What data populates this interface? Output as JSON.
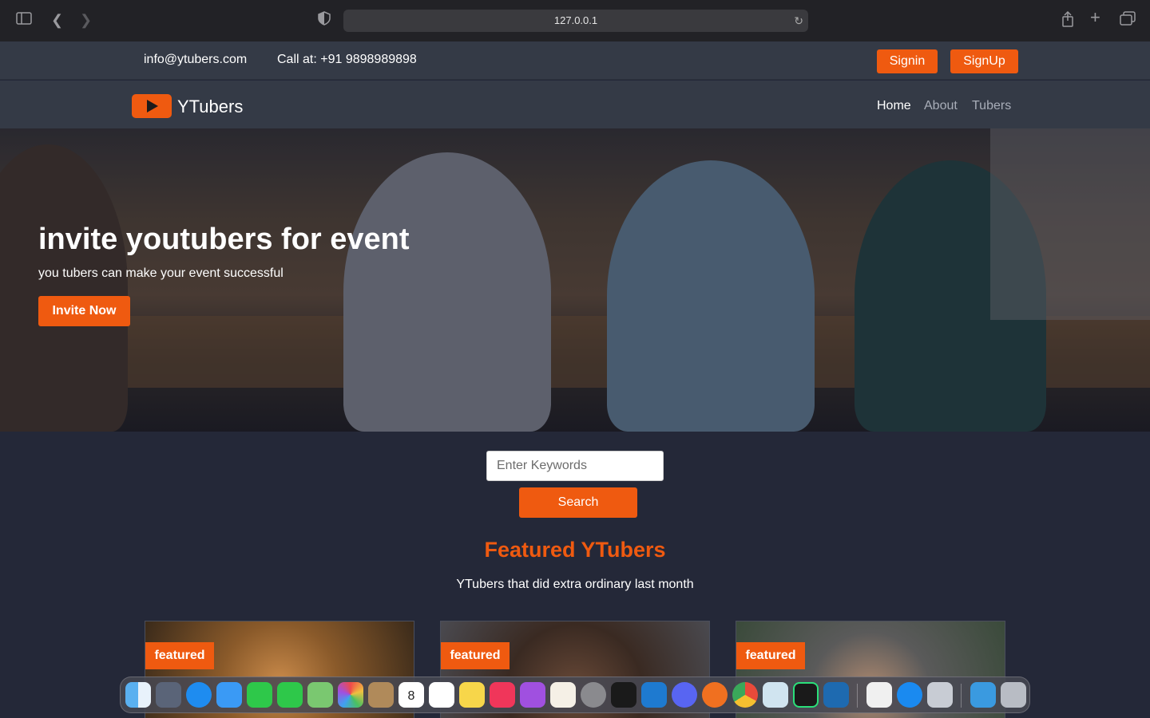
{
  "browser": {
    "url": "127.0.0.1"
  },
  "topbar": {
    "email": "info@ytubers.com",
    "phone": "Call at: +91 9898989898",
    "signin": "Signin",
    "signup": "SignUp"
  },
  "navbar": {
    "brand": "YTubers",
    "links": [
      "Home",
      "About",
      "Tubers"
    ],
    "active": "Home"
  },
  "hero": {
    "title": "invite youtubers for event",
    "subtitle": "you tubers can make your event successful",
    "cta": "Invite Now"
  },
  "search": {
    "placeholder": "Enter Keywords",
    "button": "Search"
  },
  "featured": {
    "title": "Featured YTubers",
    "subtitle": "YTubers that did extra ordinary last month",
    "cards": [
      {
        "badge": "featured"
      },
      {
        "badge": "featured"
      },
      {
        "badge": "featured"
      }
    ]
  },
  "dock": {
    "icons": [
      "finder-icon",
      "launchpad-icon",
      "safari-icon",
      "mail-icon",
      "facetime-icon",
      "messages-icon",
      "maps-icon",
      "photos-icon",
      "contacts-icon",
      "calendar-icon",
      "reminders-icon",
      "notes-icon",
      "music-icon",
      "podcasts-icon",
      "pages-icon",
      "system-preferences-icon",
      "terminal-icon",
      "vscode-icon",
      "discord-icon",
      "firefox-icon",
      "chrome-icon",
      "preview-icon",
      "pycharm-icon",
      "mysql-workbench-icon",
      "textedit-icon",
      "teamviewer-icon",
      "migration-icon",
      "downloads-icon",
      "trash-icon"
    ],
    "calendar_day": "8",
    "calendar_month": "JUN"
  }
}
